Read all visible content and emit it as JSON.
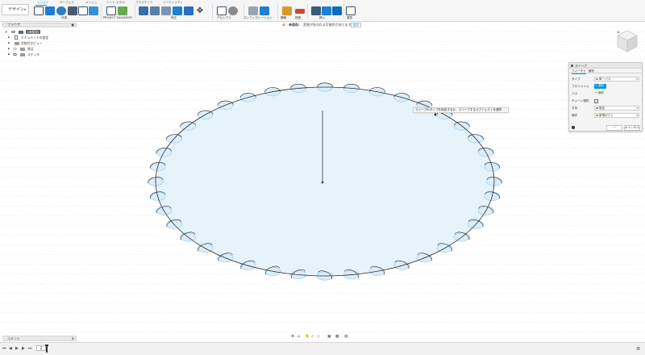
{
  "workspace": {
    "label": "デザイン",
    "caret": "▾"
  },
  "ribbon": {
    "tabs": [
      "ソリッド",
      "サーフェス",
      "メッシュ",
      "シート メタル",
      "プラスチック",
      "ユーティリティ"
    ],
    "groups": [
      "作成",
      "PROJECT SALVADOR",
      "修正",
      "アセンブリ",
      "コンフィグレーション",
      "構築",
      "検査",
      "挿入",
      "選択"
    ]
  },
  "notification": {
    "level": "未保存:",
    "message": "変更が失われる可能性があります",
    "action": "保存"
  },
  "browser": {
    "title": "ブラウザ",
    "items": [
      {
        "label": "(未保存)",
        "type": "root"
      },
      {
        "label": "ドキュメントの設定",
        "type": "doc"
      },
      {
        "label": "名前付きビュー",
        "type": "folder"
      },
      {
        "label": "原点",
        "type": "folder"
      },
      {
        "label": "スケッチ",
        "type": "folder"
      }
    ]
  },
  "tooltip": "スイープのタイプを指定するか、スイープするオブジェクトを選択",
  "sweep_dialog": {
    "title": "スイープ",
    "tabs": [
      "フィーチャ",
      "解析"
    ],
    "rows": {
      "type": {
        "label": "タイプ",
        "value": "単一パス"
      },
      "profile": {
        "label": "プロファイル",
        "value": "選択"
      },
      "path": {
        "label": "パス",
        "value": "選択"
      },
      "chain": {
        "label": "チェーン選択",
        "checked": "✓"
      },
      "direction": {
        "label": "方向",
        "value": "既定"
      },
      "operation": {
        "label": "操作",
        "value": "新規ボディ"
      }
    },
    "ok_label": "OK",
    "cancel_label": "キャンセル"
  },
  "comments": {
    "title": "コメント"
  },
  "colors": {
    "accent": "#0696d7",
    "sketch_fill": "#e6f3fa",
    "profile_fill": "#dcedf8",
    "profile_stroke": "#8fc8ea"
  }
}
